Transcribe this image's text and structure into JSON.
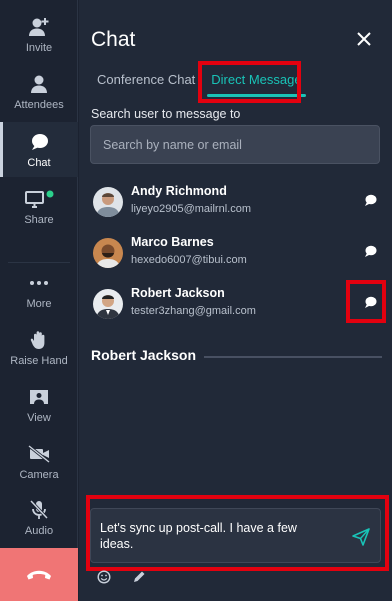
{
  "rail": {
    "items": [
      {
        "label": "Invite",
        "icon": "add-user-icon"
      },
      {
        "label": "Attendees",
        "icon": "person-icon"
      },
      {
        "label": "Chat",
        "icon": "chat-bubble-icon",
        "active": true
      },
      {
        "label": "Share",
        "icon": "screen-share-icon",
        "status": "online"
      },
      {
        "label": "More",
        "icon": "more-dots-icon"
      },
      {
        "label": "Raise Hand",
        "icon": "hand-icon"
      },
      {
        "label": "View",
        "icon": "view-icon"
      },
      {
        "label": "Camera",
        "icon": "camera-off-icon"
      },
      {
        "label": "Audio",
        "icon": "mic-off-icon"
      }
    ],
    "leave_icon": "phone-hangup-icon"
  },
  "panel": {
    "title": "Chat",
    "tabs": [
      {
        "label": "Conference Chat",
        "active": false
      },
      {
        "label": "Direct Message",
        "active": true
      }
    ],
    "search": {
      "label": "Search user to message to",
      "placeholder": "Search by name or email"
    },
    "users": [
      {
        "name": "Andy Richmond",
        "email": "liyeyo2905@mailrnl.com"
      },
      {
        "name": "Marco Barnes",
        "email": "hexedo6007@tibui.com"
      },
      {
        "name": "Robert Jackson",
        "email": "tester3zhang@gmail.com"
      }
    ],
    "conversation": {
      "recipient": "Robert Jackson"
    },
    "composer": {
      "text": "Let's sync up post-call. I have a few ideas."
    }
  },
  "colors": {
    "accent": "#19c3b7",
    "highlight": "#e3010f",
    "leave": "#f07575"
  }
}
